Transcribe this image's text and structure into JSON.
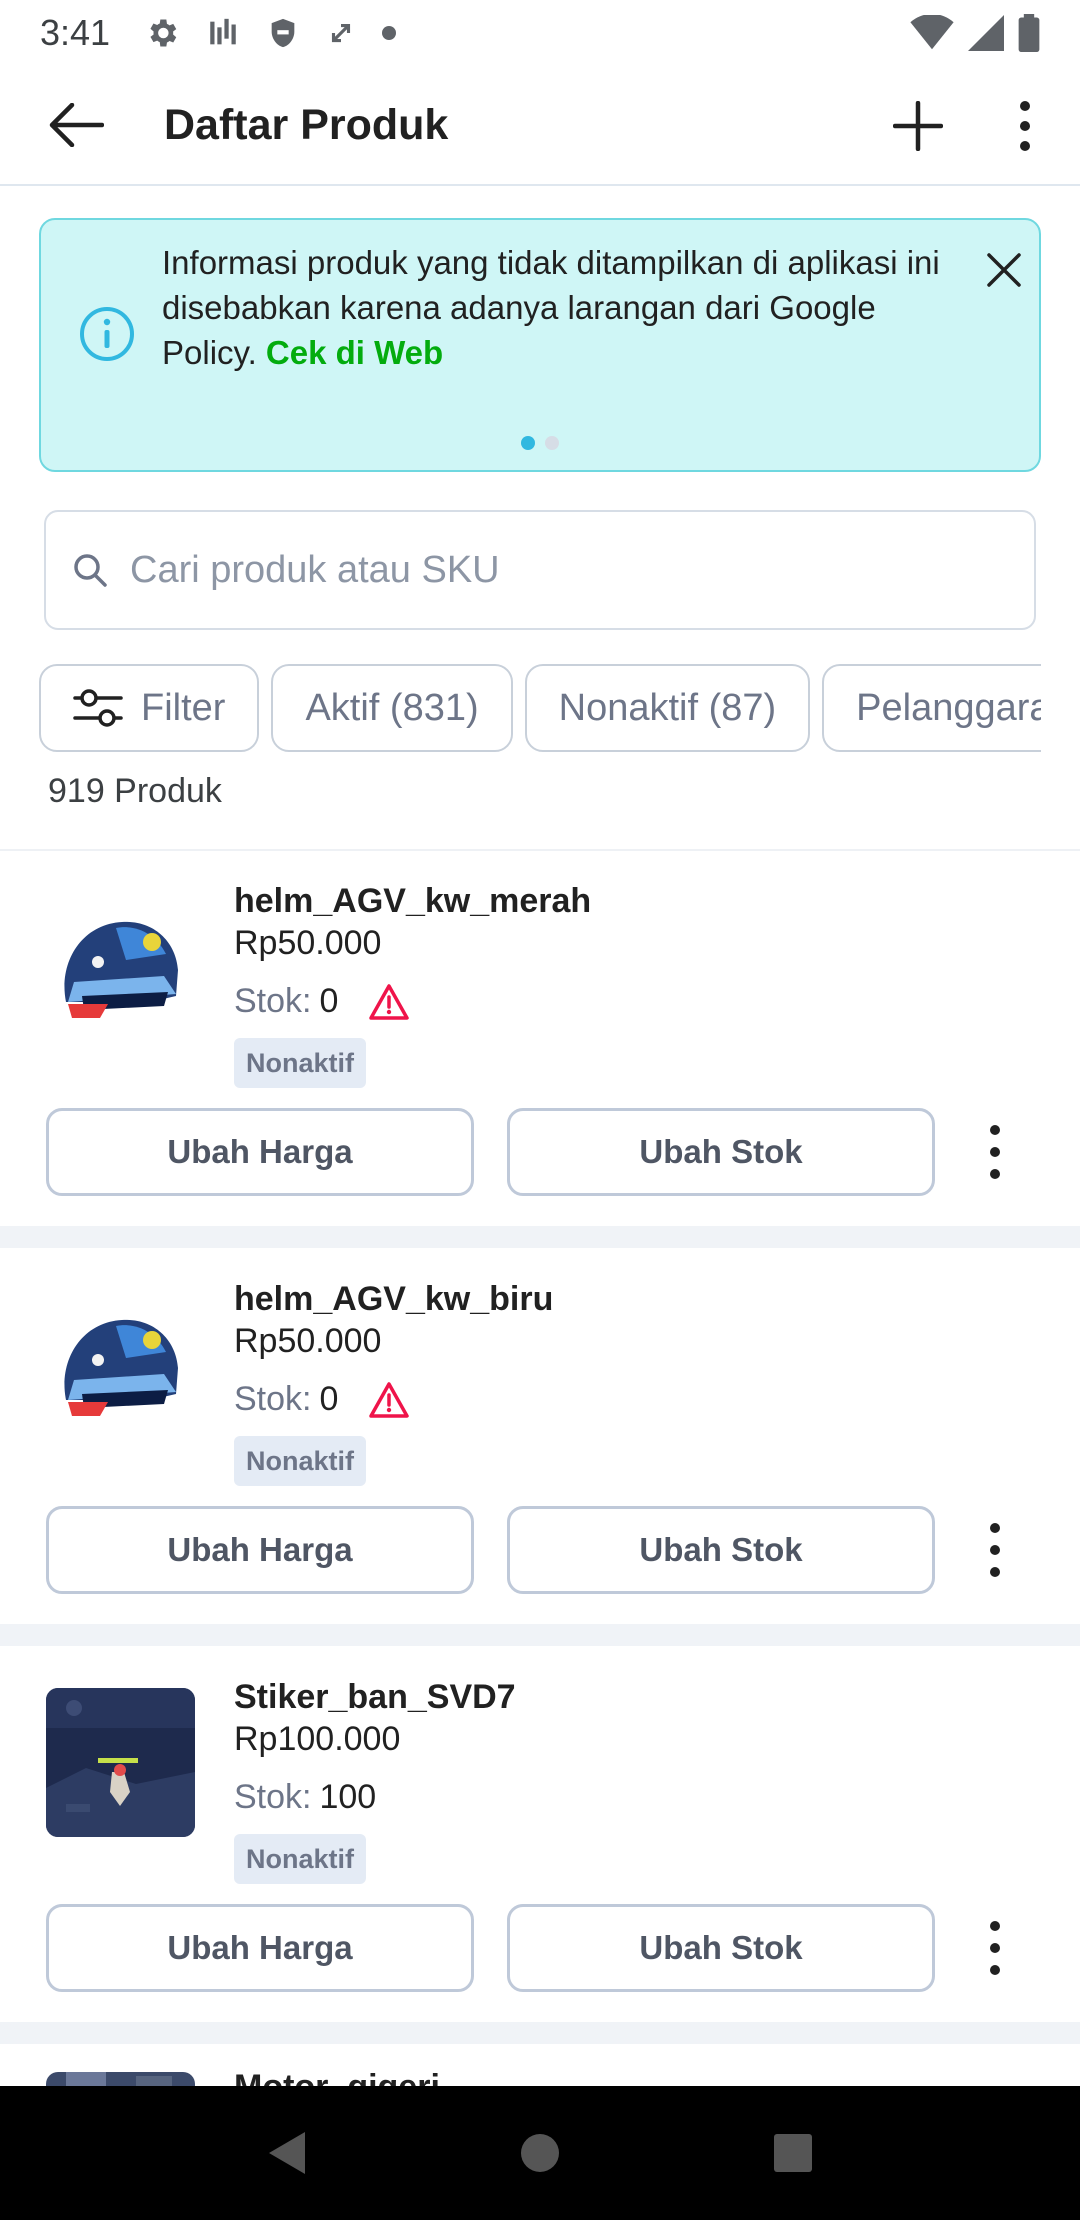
{
  "status_bar": {
    "time": "3:41",
    "icons": [
      "gear-icon",
      "signal-bars-icon",
      "shield-icon",
      "sync-icon",
      "dot-icon"
    ],
    "right_icons": [
      "wifi-icon",
      "cell-signal-icon",
      "battery-icon"
    ]
  },
  "app_bar": {
    "title": "Daftar Produk"
  },
  "banner": {
    "text": "Informasi produk yang tidak ditampilkan di aplikasi ini disebabkan karena adanya larangan dari Google Policy. ",
    "link": "Cek di Web",
    "page_index": 1,
    "page_count": 2,
    "colors": {
      "background": "#cff6f6",
      "border": "#6fd8e0",
      "link": "#03ac0e",
      "info": "#31b8e0"
    }
  },
  "search": {
    "placeholder": "Cari produk atau SKU",
    "value": ""
  },
  "chips": {
    "filter": "Filter",
    "active": "Aktif (831)",
    "inactive": "Nonaktif (87)",
    "more": "Pelanggaran"
  },
  "product_count": "919 Produk",
  "products": [
    {
      "name": "helm_AGV_kw_merah",
      "price": "Rp50.000",
      "stock_label": "Stok:",
      "stock": "0",
      "warning": true,
      "status": "Nonaktif",
      "edit_price": "Ubah Harga",
      "edit_stock": "Ubah Stok",
      "image": "helmet"
    },
    {
      "name": "helm_AGV_kw_biru",
      "price": "Rp50.000",
      "stock_label": "Stok:",
      "stock": "0",
      "warning": true,
      "status": "Nonaktif",
      "edit_price": "Ubah Harga",
      "edit_stock": "Ubah Stok",
      "image": "helmet"
    },
    {
      "name": "Stiker_ban_SVD7",
      "price": "Rp100.000",
      "stock_label": "Stok:",
      "stock": "100",
      "warning": false,
      "status": "Nonaktif",
      "edit_price": "Ubah Harga",
      "edit_stock": "Ubah Stok",
      "image": "game-scene"
    },
    {
      "name": "Motor_gigeri",
      "image": "street-scene"
    }
  ],
  "nav_bar": {
    "icons": [
      "back-triangle-icon",
      "home-circle-icon",
      "recents-square-icon"
    ]
  }
}
